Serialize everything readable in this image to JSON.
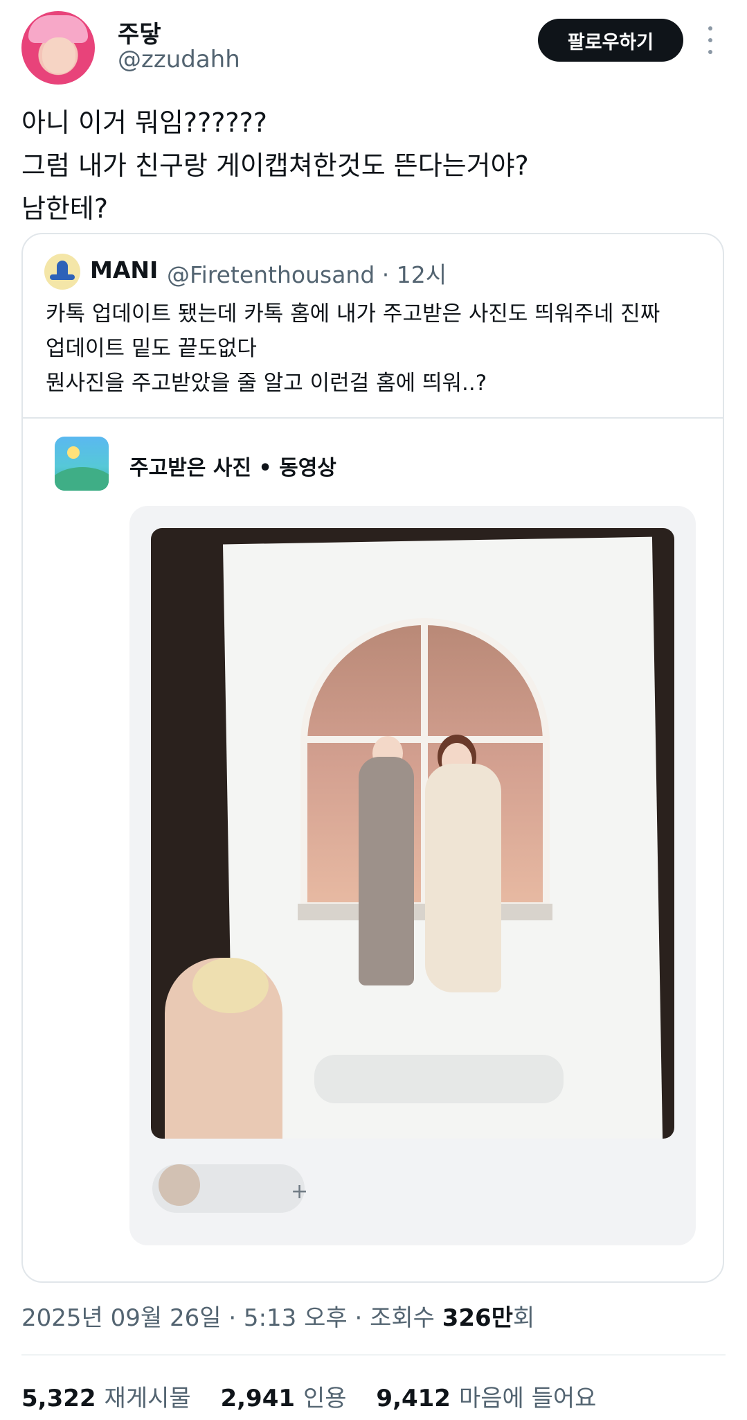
{
  "author": {
    "display_name": "주닿",
    "handle": "@zzudahh",
    "follow_label": "팔로우하기"
  },
  "tweet": {
    "lines": [
      "아니 이거 뭐임??????",
      "그럼 내가 친구랑 게이캡쳐한것도 뜬다는거야?",
      "남한테?"
    ]
  },
  "quote": {
    "name": "MANI",
    "handle_time": "@Firetenthousand · 12시",
    "lines": [
      "카톡 업데이트 됐는데 카톡 홈에 내가 주고받은 사진도 띄워주네 진짜",
      "업데이트 밑도 끝도없다",
      "뭔사진을 주고받았을 줄 알고 이런걸 홈에 띄워..?"
    ],
    "embed": {
      "section_label": "주고받은 사진 • 동영상",
      "sender_plus": "+"
    }
  },
  "meta": {
    "date_time": "2025년 09월 26일 · 5:13 오후 · 조회수 ",
    "views": "326만",
    "views_suffix": "회"
  },
  "stats": {
    "retweets": "5,322",
    "retweets_label": "재게시물",
    "quotes": "2,941",
    "quotes_label": "인용",
    "likes": "9,412",
    "likes_label": "마음에 들어요"
  },
  "icons": {
    "more": "more-vertical-icon",
    "gallery": "gallery-icon"
  },
  "colors": {
    "follow_button_bg": "#0f1419",
    "secondary_text": "#536471",
    "border": "#e1e6ea"
  }
}
